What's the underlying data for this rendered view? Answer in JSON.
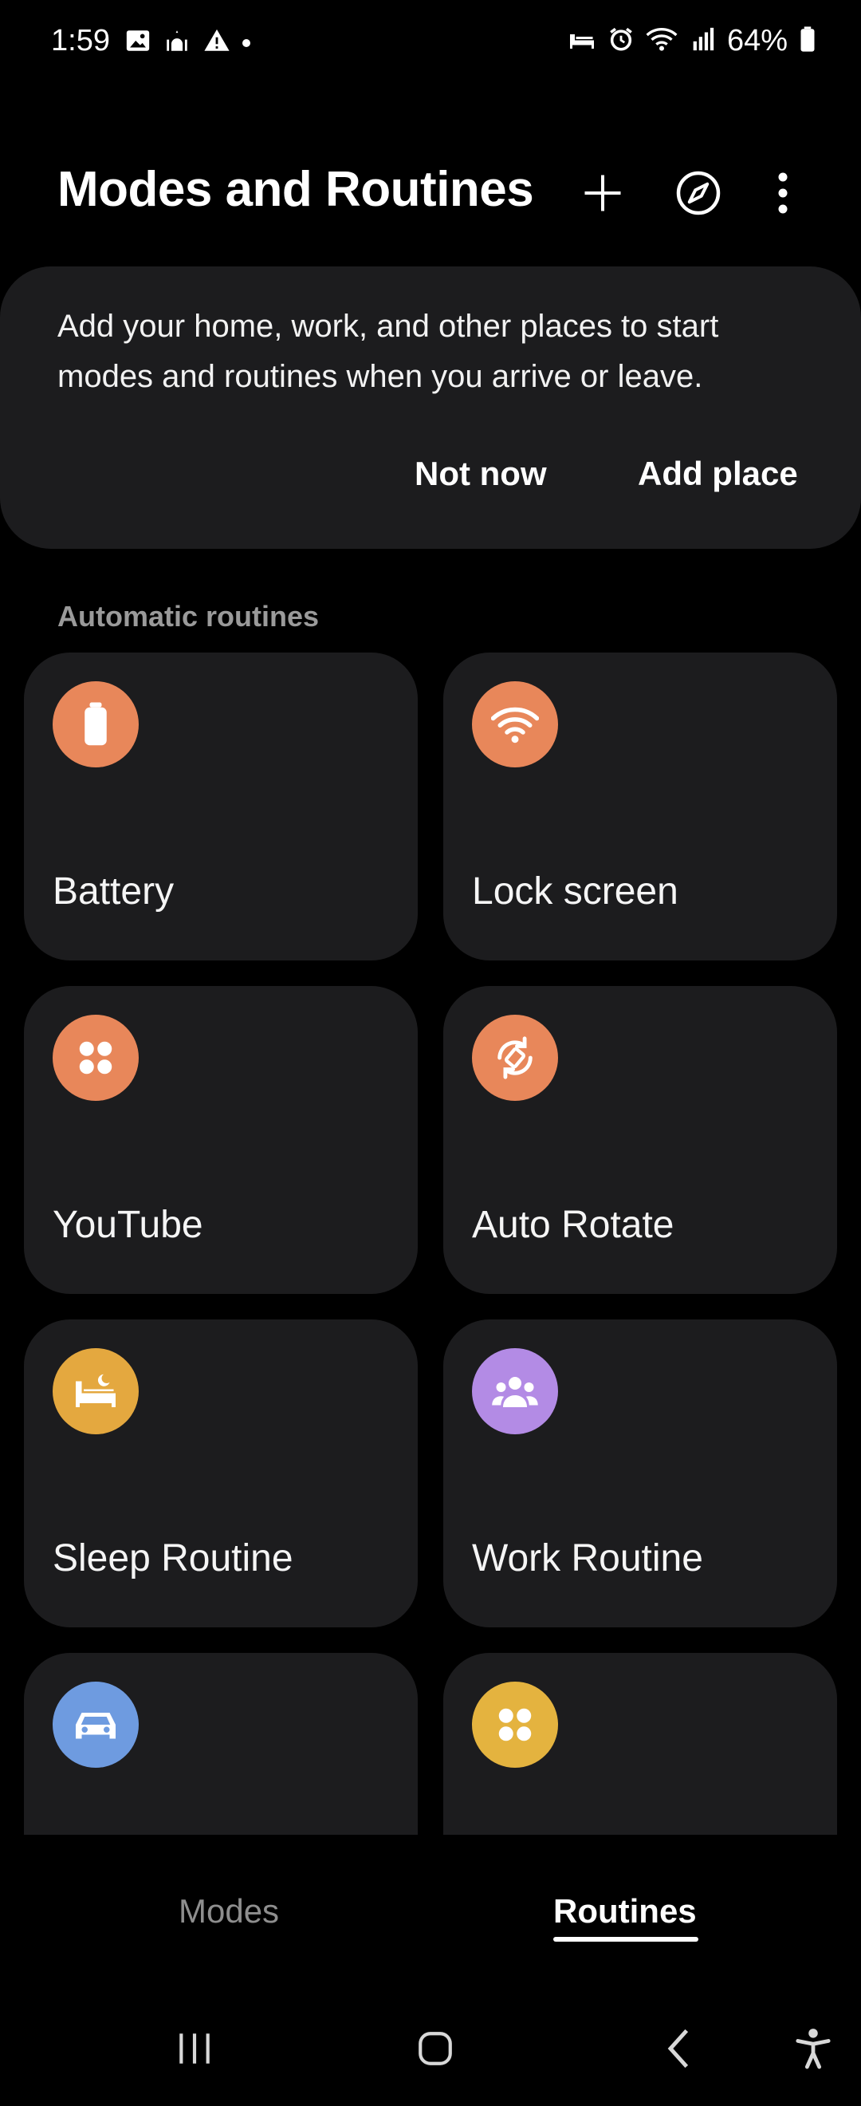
{
  "status_bar": {
    "time": "1:59",
    "battery_percent": "64%",
    "left_icons": [
      "image-icon",
      "mosque-icon",
      "warning-icon",
      "dot-icon"
    ],
    "right_icons": [
      "sleep-icon",
      "alarm-icon",
      "wifi-icon",
      "signal-icon",
      "battery-icon"
    ]
  },
  "header": {
    "title": "Modes and Routines",
    "actions": [
      "add-icon",
      "discover-icon",
      "more-options-icon"
    ]
  },
  "banner": {
    "text": "Add your home, work, and other places to start modes and routines when you arrive or leave.",
    "not_now_label": "Not now",
    "add_place_label": "Add place"
  },
  "section": {
    "automatic_routines_label": "Automatic routines"
  },
  "routines": [
    {
      "label": "Battery",
      "icon": "battery-icon",
      "color": "#E8875A"
    },
    {
      "label": "Lock screen",
      "icon": "wifi-icon",
      "color": "#E8875A"
    },
    {
      "label": "YouTube",
      "icon": "apps-icon",
      "color": "#E8875A"
    },
    {
      "label": "Auto Rotate",
      "icon": "rotate-icon",
      "color": "#E8875A"
    },
    {
      "label": "Sleep Routine",
      "icon": "bed-icon",
      "color": "#E4A83F"
    },
    {
      "label": "Work Routine",
      "icon": "group-icon",
      "color": "#B38BE5"
    },
    {
      "label": "",
      "icon": "car-icon",
      "color": "#6E9BE0"
    },
    {
      "label": "",
      "icon": "apps-icon",
      "color": "#E4B33F"
    }
  ],
  "tabs": {
    "modes_label": "Modes",
    "routines_label": "Routines",
    "active": "Routines"
  },
  "nav_bar": [
    "recent-apps-icon",
    "home-icon",
    "back-icon",
    "accessibility-icon"
  ]
}
